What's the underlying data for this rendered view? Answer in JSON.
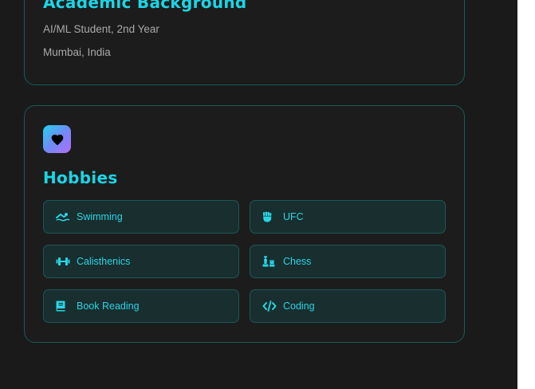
{
  "academic": {
    "title": "Academic Background",
    "lines": [
      "AI/ML Student, 2nd Year",
      "Mumbai, India"
    ]
  },
  "hobbies": {
    "title": "Hobbies",
    "badge_icon": "heart-icon",
    "items": [
      {
        "label": "Swimming",
        "icon": "swimmer-icon"
      },
      {
        "label": "UFC",
        "icon": "fist-icon"
      },
      {
        "label": "Calisthenics",
        "icon": "dumbbell-icon"
      },
      {
        "label": "Chess",
        "icon": "chess-icon"
      },
      {
        "label": "Book Reading",
        "icon": "book-icon"
      },
      {
        "label": "Coding",
        "icon": "code-icon"
      }
    ]
  },
  "colors": {
    "accent": "#19d6e6",
    "background": "#1a1a1a",
    "card_border": "#1b5a5a",
    "hobby_bg": "#182e2f"
  }
}
